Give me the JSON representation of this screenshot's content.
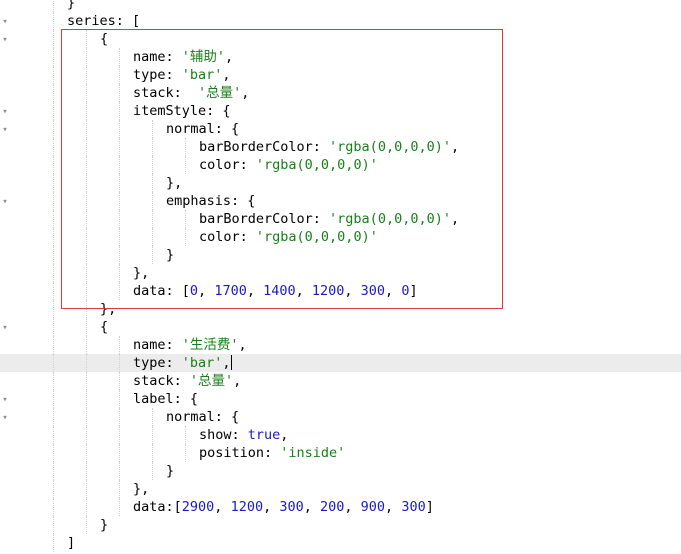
{
  "editor": {
    "lines": [
      {
        "indent": 2,
        "fold": false,
        "tokens": [
          {
            "t": "}",
            "c": "p"
          }
        ]
      },
      {
        "indent": 2,
        "fold": true,
        "tokens": [
          {
            "t": "series: [",
            "c": "k"
          }
        ]
      },
      {
        "indent": 3,
        "fold": true,
        "tokens": [
          {
            "t": "{",
            "c": "p"
          }
        ]
      },
      {
        "indent": 4,
        "fold": false,
        "tokens": [
          {
            "t": "name: ",
            "c": "k"
          },
          {
            "t": "'辅助'",
            "c": "s"
          },
          {
            "t": ",",
            "c": "p"
          }
        ]
      },
      {
        "indent": 4,
        "fold": false,
        "tokens": [
          {
            "t": "type: ",
            "c": "k"
          },
          {
            "t": "'bar'",
            "c": "s"
          },
          {
            "t": ",",
            "c": "p"
          }
        ]
      },
      {
        "indent": 4,
        "fold": false,
        "tokens": [
          {
            "t": "stack:  ",
            "c": "k"
          },
          {
            "t": "'总量'",
            "c": "s"
          },
          {
            "t": ",",
            "c": "p"
          }
        ]
      },
      {
        "indent": 4,
        "fold": true,
        "tokens": [
          {
            "t": "itemStyle: {",
            "c": "k"
          }
        ]
      },
      {
        "indent": 5,
        "fold": true,
        "tokens": [
          {
            "t": "normal: {",
            "c": "k"
          }
        ]
      },
      {
        "indent": 6,
        "fold": false,
        "tokens": [
          {
            "t": "barBorderColor: ",
            "c": "k"
          },
          {
            "t": "'rgba(0,0,0,0)'",
            "c": "s"
          },
          {
            "t": ",",
            "c": "p"
          }
        ]
      },
      {
        "indent": 6,
        "fold": false,
        "tokens": [
          {
            "t": "color: ",
            "c": "k"
          },
          {
            "t": "'rgba(0,0,0,0)'",
            "c": "s"
          }
        ]
      },
      {
        "indent": 5,
        "fold": false,
        "tokens": [
          {
            "t": "},",
            "c": "p"
          }
        ]
      },
      {
        "indent": 5,
        "fold": true,
        "tokens": [
          {
            "t": "emphasis: {",
            "c": "k"
          }
        ]
      },
      {
        "indent": 6,
        "fold": false,
        "tokens": [
          {
            "t": "barBorderColor: ",
            "c": "k"
          },
          {
            "t": "'rgba(0,0,0,0)'",
            "c": "s"
          },
          {
            "t": ",",
            "c": "p"
          }
        ]
      },
      {
        "indent": 6,
        "fold": false,
        "tokens": [
          {
            "t": "color: ",
            "c": "k"
          },
          {
            "t": "'rgba(0,0,0,0)'",
            "c": "s"
          }
        ]
      },
      {
        "indent": 5,
        "fold": false,
        "tokens": [
          {
            "t": "}",
            "c": "p"
          }
        ]
      },
      {
        "indent": 4,
        "fold": false,
        "tokens": [
          {
            "t": "},",
            "c": "p"
          }
        ]
      },
      {
        "indent": 4,
        "fold": false,
        "tokens": [
          {
            "t": "data: [",
            "c": "k"
          },
          {
            "t": "0",
            "c": "n"
          },
          {
            "t": ", ",
            "c": "p"
          },
          {
            "t": "1700",
            "c": "n"
          },
          {
            "t": ", ",
            "c": "p"
          },
          {
            "t": "1400",
            "c": "n"
          },
          {
            "t": ", ",
            "c": "p"
          },
          {
            "t": "1200",
            "c": "n"
          },
          {
            "t": ", ",
            "c": "p"
          },
          {
            "t": "300",
            "c": "n"
          },
          {
            "t": ", ",
            "c": "p"
          },
          {
            "t": "0",
            "c": "n"
          },
          {
            "t": "]",
            "c": "p"
          }
        ]
      },
      {
        "indent": 3,
        "fold": false,
        "tokens": [
          {
            "t": "},",
            "c": "p"
          }
        ]
      },
      {
        "indent": 3,
        "fold": true,
        "tokens": [
          {
            "t": "{",
            "c": "p"
          }
        ]
      },
      {
        "indent": 4,
        "fold": false,
        "tokens": [
          {
            "t": "name: ",
            "c": "k"
          },
          {
            "t": "'生活费'",
            "c": "s"
          },
          {
            "t": ",",
            "c": "p"
          }
        ]
      },
      {
        "indent": 4,
        "fold": false,
        "active": true,
        "cursor": true,
        "tokens": [
          {
            "t": "type: ",
            "c": "k"
          },
          {
            "t": "'bar'",
            "c": "s"
          },
          {
            "t": ",",
            "c": "p"
          }
        ]
      },
      {
        "indent": 4,
        "fold": false,
        "tokens": [
          {
            "t": "stack: ",
            "c": "k"
          },
          {
            "t": "'总量'",
            "c": "s"
          },
          {
            "t": ",",
            "c": "p"
          }
        ]
      },
      {
        "indent": 4,
        "fold": true,
        "tokens": [
          {
            "t": "label: {",
            "c": "k"
          }
        ]
      },
      {
        "indent": 5,
        "fold": true,
        "tokens": [
          {
            "t": "normal: {",
            "c": "k"
          }
        ]
      },
      {
        "indent": 6,
        "fold": false,
        "tokens": [
          {
            "t": "show: ",
            "c": "k"
          },
          {
            "t": "true",
            "c": "b"
          },
          {
            "t": ",",
            "c": "p"
          }
        ]
      },
      {
        "indent": 6,
        "fold": false,
        "tokens": [
          {
            "t": "position: ",
            "c": "k"
          },
          {
            "t": "'inside'",
            "c": "s"
          }
        ]
      },
      {
        "indent": 5,
        "fold": false,
        "tokens": [
          {
            "t": "}",
            "c": "p"
          }
        ]
      },
      {
        "indent": 4,
        "fold": false,
        "tokens": [
          {
            "t": "},",
            "c": "p"
          }
        ]
      },
      {
        "indent": 4,
        "fold": false,
        "tokens": [
          {
            "t": "data:[",
            "c": "k"
          },
          {
            "t": "2900",
            "c": "n"
          },
          {
            "t": ", ",
            "c": "p"
          },
          {
            "t": "1200",
            "c": "n"
          },
          {
            "t": ", ",
            "c": "p"
          },
          {
            "t": "300",
            "c": "n"
          },
          {
            "t": ", ",
            "c": "p"
          },
          {
            "t": "200",
            "c": "n"
          },
          {
            "t": ", ",
            "c": "p"
          },
          {
            "t": "900",
            "c": "n"
          },
          {
            "t": ", ",
            "c": "p"
          },
          {
            "t": "300",
            "c": "n"
          },
          {
            "t": "]",
            "c": "p"
          }
        ]
      },
      {
        "indent": 3,
        "fold": false,
        "tokens": [
          {
            "t": "}",
            "c": "p"
          }
        ]
      },
      {
        "indent": 2,
        "fold": false,
        "tokens": [
          {
            "t": "]",
            "c": "p"
          }
        ]
      },
      {
        "indent": 0,
        "fold": false,
        "tokens": [
          {
            "t": "};",
            "c": "p"
          }
        ]
      }
    ],
    "fold_icon": "chevron-down-icon",
    "colors": {
      "keyword": "#000000",
      "string": "#1a7f1a",
      "number": "#1a1acc",
      "highlight_border": "#e0393e",
      "active_line": "#ececec"
    }
  }
}
